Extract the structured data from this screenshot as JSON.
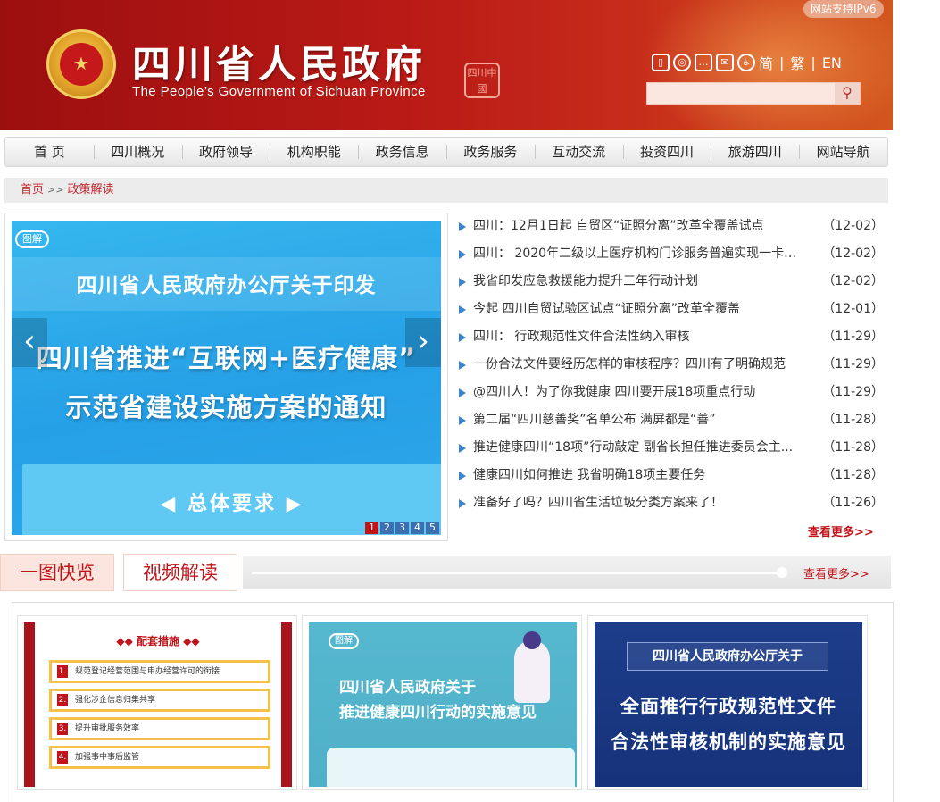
{
  "header": {
    "ipv6_badge": "网站支持IPv6",
    "title": "四川省人民政府",
    "subtitle": "The People’s Government of Sichuan Province",
    "seal_text": "四川中國",
    "lang_simplified": "简",
    "lang_traditional": "繁",
    "lang_english": "EN",
    "separator": "|",
    "icons": [
      "mobile-icon",
      "weibo-icon",
      "wechat-icon",
      "mail-icon",
      "accessibility-icon"
    ],
    "search_placeholder": ""
  },
  "nav": {
    "items": [
      "首 页",
      "四川概况",
      "政府领导",
      "机构职能",
      "政务信息",
      "政务服务",
      "互动交流",
      "投资四川",
      "旅游四川",
      "网站导航"
    ]
  },
  "breadcrumb": {
    "home": "首页",
    "separator": ">>",
    "current": "政策解读"
  },
  "slider": {
    "tag": "图解",
    "line1": "四川省人民政府办公厅关于印发",
    "line2": "四川省推进“互联网+医疗健康”",
    "line3": "示范省建设实施方案的通知",
    "panel_text": "总体要求",
    "prev": "‹",
    "next": "›",
    "pages": [
      "1",
      "2",
      "3",
      "4",
      "5"
    ],
    "active_page": 1
  },
  "news": {
    "items": [
      {
        "title": "四川：12月1日起 自贸区“证照分离”改革全覆盖试点",
        "date": "（12-02）"
      },
      {
        "title": "四川： 2020年二级以上医疗机构门诊服务普遍实现一卡（...",
        "date": "（12-02）"
      },
      {
        "title": "我省印发应急救援能力提升三年行动计划",
        "date": "（12-02）"
      },
      {
        "title": "今起 四川自贸试验区试点“证照分离”改革全覆盖",
        "date": "（12-01）"
      },
      {
        "title": "四川： 行政规范性文件合法性纳入审核",
        "date": "（11-29）"
      },
      {
        "title": "一份合法文件要经历怎样的审核程序？四川有了明确规范",
        "date": "（11-29）"
      },
      {
        "title": "@四川人！为了你我健康 四川要开展18项重点行动",
        "date": "（11-29）"
      },
      {
        "title": "第二届“四川慈善奖”名单公布 满屏都是“善”",
        "date": "（11-28）"
      },
      {
        "title": "推进健康四川“18项”行动敲定 副省长担任推进委员会主...",
        "date": "（11-28）"
      },
      {
        "title": "健康四川如何推进 我省明确18项主要任务",
        "date": "（11-28）"
      },
      {
        "title": "准备好了吗？四川省生活垃圾分类方案来了！",
        "date": "（11-26）"
      }
    ],
    "more": "查看更多>>"
  },
  "tabs": {
    "tab1": "一图快览",
    "tab2": "视频解读",
    "more": "查看更多>>"
  },
  "cards": {
    "card1": {
      "heading": "◆◆ 配套措施 ◆◆",
      "rows": [
        {
          "num": "1.",
          "text": "规范登记经营范围与申办经营许可的衔接"
        },
        {
          "num": "2.",
          "text": "强化涉企信息归集共享"
        },
        {
          "num": "3.",
          "text": "提升审批服务效率"
        },
        {
          "num": "4.",
          "text": "加强事中事后监管"
        }
      ]
    },
    "card2": {
      "tag": "图解",
      "line1": "四川省人民政府关于",
      "line2": "推进健康四川行动的实施意见"
    },
    "card3": {
      "box": "四川省人民政府办公厅关于",
      "line1": "全面推行行政规范性文件",
      "line2": "合法性审核机制的实施意见"
    }
  },
  "colors": {
    "brand_red": "#c0141a",
    "header_red": "#b91a16",
    "accent_blue": "#3b86c8"
  }
}
